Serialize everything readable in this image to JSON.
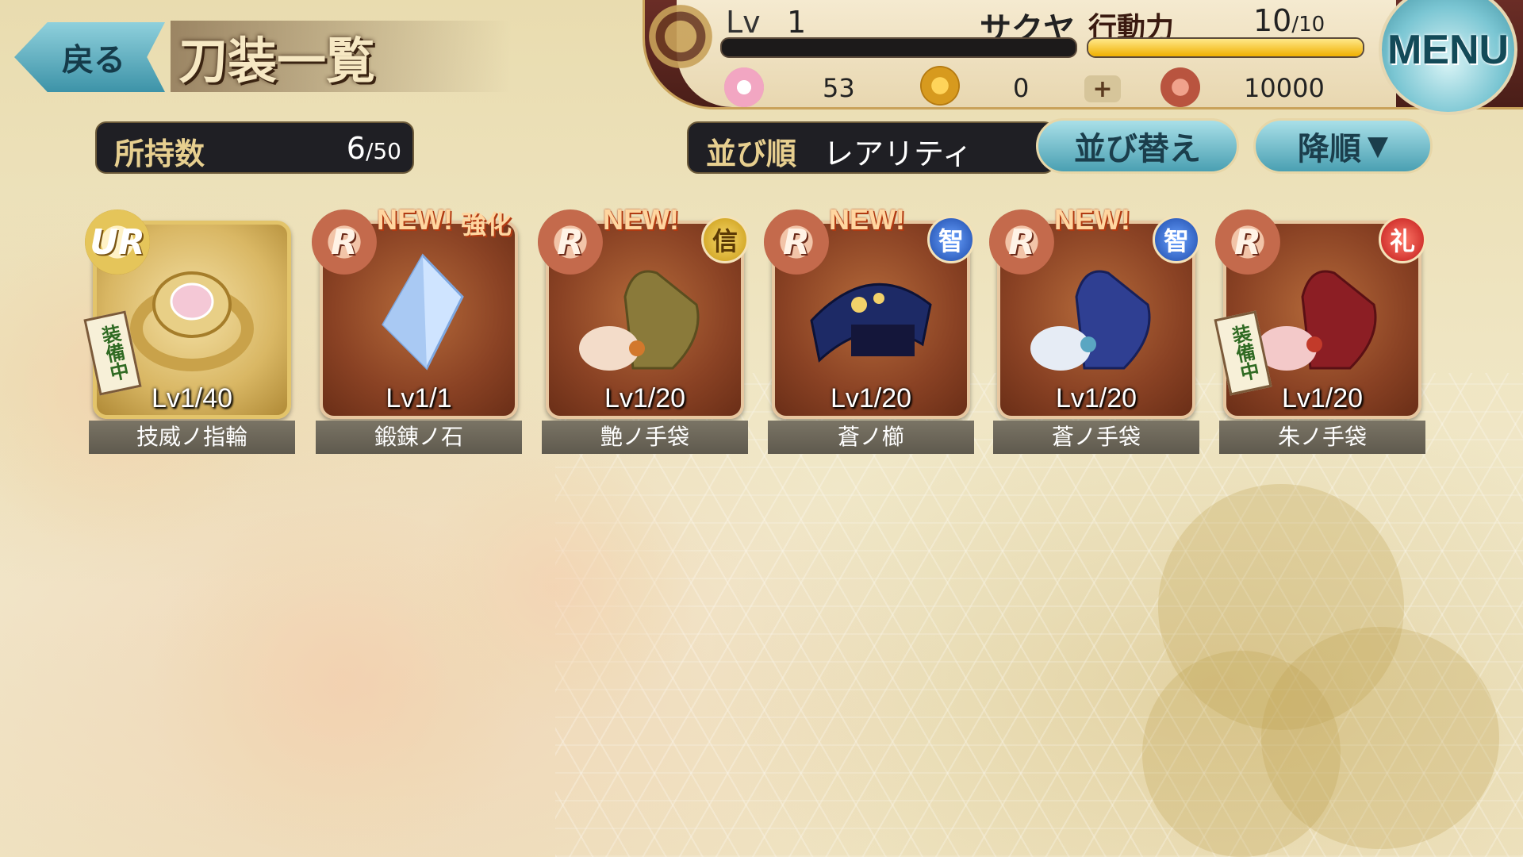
{
  "nav": {
    "back_label": "戻る",
    "title": "刀装一覧",
    "menu_label": "MENU"
  },
  "status": {
    "level_label": "Lv",
    "level_value": "1",
    "player_name": "サクヤ",
    "stamina_label": "行動力",
    "stamina_current": "10",
    "stamina_max": "/10",
    "exp_progress": 0,
    "stamina_progress": 1.0,
    "sakura_value": "53",
    "coin_value": "0",
    "token_value": "10000"
  },
  "inventory": {
    "count_label": "所持数",
    "count_current": "6",
    "count_max": "/50"
  },
  "sort": {
    "label": "並び順",
    "value": "レアリティ",
    "sort_button": "並び替え",
    "order_button": "降順",
    "order_arrow": "▼"
  },
  "cards": [
    {
      "rarity": "UR",
      "level": "Lv1/40",
      "name": "技威ノ指輪",
      "equipped": "装備中",
      "new": "",
      "enhance": "",
      "attr": ""
    },
    {
      "rarity": "R",
      "level": "Lv1/1",
      "name": "鍛錬ノ石",
      "equipped": "",
      "new": "NEW!",
      "enhance": "強化",
      "attr": ""
    },
    {
      "rarity": "R",
      "level": "Lv1/20",
      "name": "艶ノ手袋",
      "equipped": "",
      "new": "NEW!",
      "enhance": "",
      "attr": "信"
    },
    {
      "rarity": "R",
      "level": "Lv1/20",
      "name": "蒼ノ櫛",
      "equipped": "",
      "new": "NEW!",
      "enhance": "",
      "attr": "智"
    },
    {
      "rarity": "R",
      "level": "Lv1/20",
      "name": "蒼ノ手袋",
      "equipped": "",
      "new": "NEW!",
      "enhance": "",
      "attr": "智"
    },
    {
      "rarity": "R",
      "level": "Lv1/20",
      "name": "朱ノ手袋",
      "equipped": "装備中",
      "new": "",
      "enhance": "",
      "attr": "礼"
    }
  ],
  "colors": {
    "accent_teal": "#4aa0b2",
    "panel_dark": "#1f1f24",
    "gold_text": "#e7cf8f"
  }
}
